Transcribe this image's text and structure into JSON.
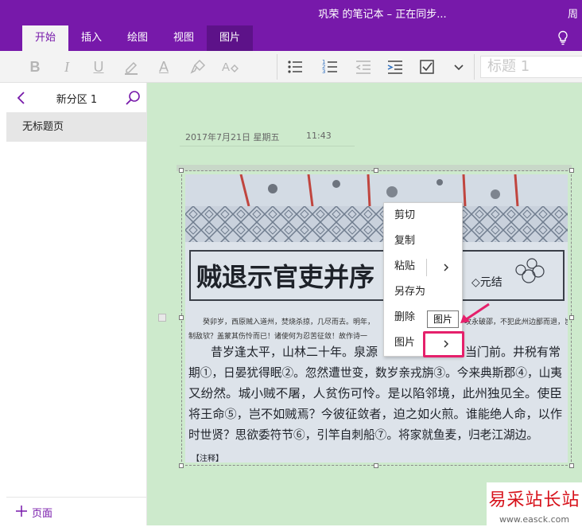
{
  "window": {
    "title": "巩荣 的笔记本 – 正在同步...",
    "user": "周"
  },
  "tabs": [
    {
      "label": "开始"
    },
    {
      "label": "插入"
    },
    {
      "label": "绘图"
    },
    {
      "label": "视图"
    },
    {
      "label": "图片"
    }
  ],
  "ribbon": {
    "bold": "B",
    "italic": "I",
    "underline": "U",
    "font_color": "A",
    "style": "标题 1"
  },
  "sidebar": {
    "section": "新分区 1",
    "page": "无标题页",
    "add_page": "页面"
  },
  "note": {
    "date": "2017年7月21日  星期五",
    "time": "11:43"
  },
  "photo_text": {
    "heading": "贼退示官吏并序",
    "author": "◇元结",
    "small1": "癸卯岁，西原贼入道州，焚烧杀掠，几尽而去。明年，",
    "small1b": "之。其后，攻永破邵，不犯此州边鄙而退，岂力能",
    "small2": "制敌欤？盖蒙其伤怜而已！诸使何为忍苦征敛！故作诗一",
    "line1a": "昔岁逢太平，山林二十年。泉源",
    "line1b": "当门前。井税有常",
    "line2": "期①，日晏犹得眠②。忽然遭世变，数岁亲戎旃③。今来典斯郡④，山夷",
    "line3": "又纷然。城小贼不屠，人贫伤可怜。是以陷邻境，此州独见全。使臣",
    "line4": "将王命⑤，岂不如贼焉？今彼征敛者，迫之如火煎。谁能绝人命，以作",
    "line5": "时世贤？思欲委符节⑥，引竿自刺船⑦。将家就鱼麦，归老江湖边。",
    "footnote": "【注释】"
  },
  "context_menu": {
    "items": [
      "剪切",
      "复制",
      "粘贴",
      "另存为",
      "删除",
      "图片"
    ]
  },
  "tooltip": "图片",
  "watermark": {
    "main": "易采站长站",
    "sub": "www.easck.com"
  },
  "colors": {
    "accent": "#7719aa",
    "canvas": "#cdeacc",
    "highlight": "#e5206b",
    "watermark": "#d7111a"
  }
}
